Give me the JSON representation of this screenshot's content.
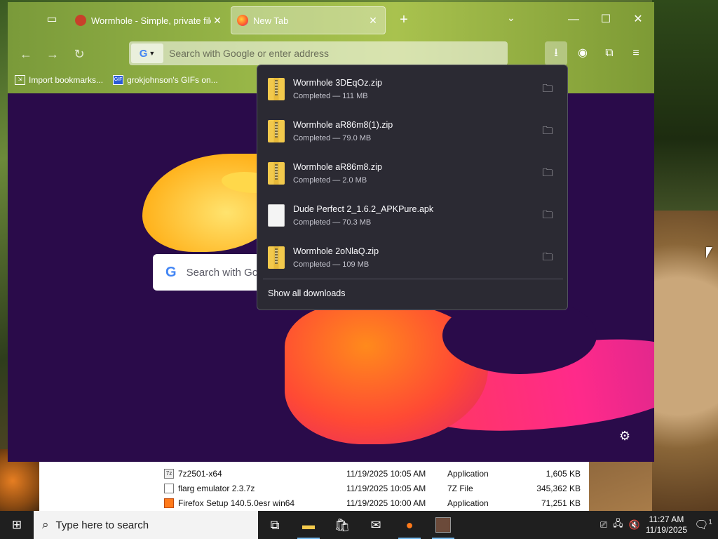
{
  "browser": {
    "tabs": [
      {
        "label": "Wormhole - Simple, private file",
        "active": false
      },
      {
        "label": "New Tab",
        "active": true
      }
    ],
    "url_placeholder": "Search with Google or enter address",
    "bookmarks": [
      "Import bookmarks...",
      "grokjohnson's GIFs on..."
    ],
    "newtab_search_placeholder": "Search with Go"
  },
  "downloads": {
    "items": [
      {
        "name": "Wormhole 3DEqOz.zip",
        "status": "Completed — 111 MB",
        "type": "zip"
      },
      {
        "name": "Wormhole aR86m8(1).zip",
        "status": "Completed — 79.0 MB",
        "type": "zip"
      },
      {
        "name": "Wormhole aR86m8.zip",
        "status": "Completed — 2.0 MB",
        "type": "zip"
      },
      {
        "name": "Dude Perfect 2_1.6.2_APKPure.apk",
        "status": "Completed — 70.3 MB",
        "type": "doc"
      },
      {
        "name": "Wormhole 2oNlaQ.zip",
        "status": "Completed — 109 MB",
        "type": "zip"
      }
    ],
    "show_all": "Show all downloads"
  },
  "explorer": {
    "rows": [
      {
        "name": "7z2501-x64",
        "date": "11/19/2025 10:05 AM",
        "type": "Application",
        "size": "1,605 KB"
      },
      {
        "name": "flarg emulator 2.3.7z",
        "date": "11/19/2025 10:05 AM",
        "type": "7Z File",
        "size": "345,362 KB"
      },
      {
        "name": "Firefox Setup 140.5.0esr win64",
        "date": "11/19/2025 10:00 AM",
        "type": "Application",
        "size": "71,251 KB"
      }
    ]
  },
  "taskbar": {
    "search_placeholder": "Type here to search",
    "time": "11:27 AM",
    "date": "11/19/2025",
    "notif_count": "1"
  },
  "colors": {
    "panel_bg": "#2b2a33",
    "newtab_bg": "#2a0b4a",
    "accent": "#76b9ed"
  }
}
